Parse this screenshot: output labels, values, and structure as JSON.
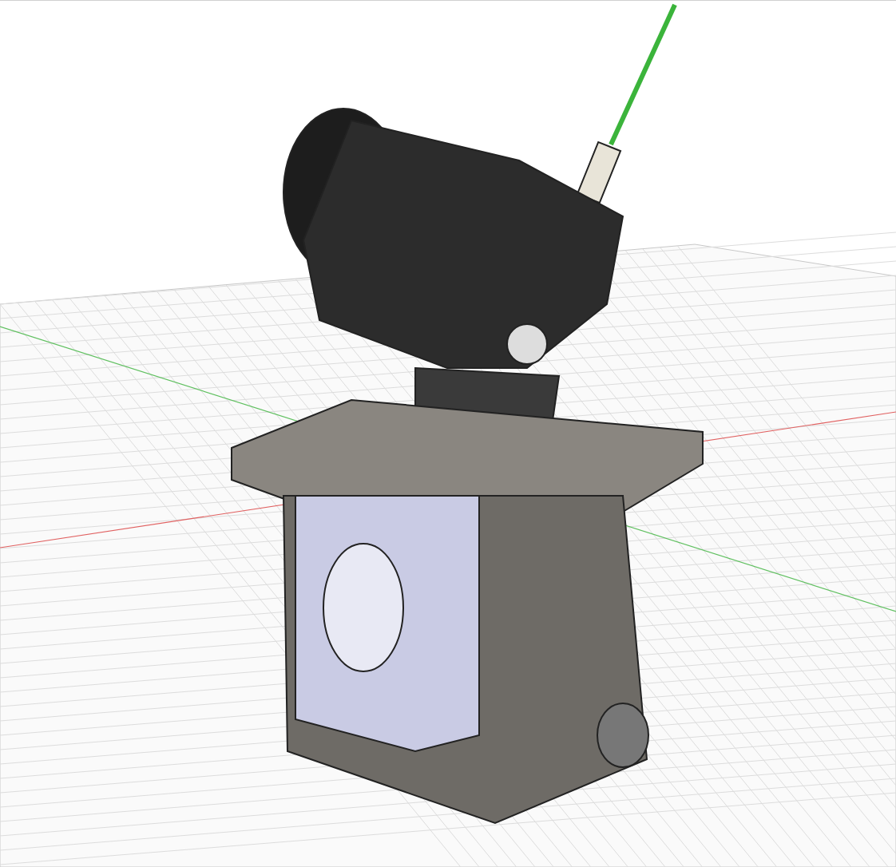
{
  "viewport": {
    "grid_visible": true,
    "axes": [
      {
        "kind": "x",
        "color": "#e06060"
      },
      {
        "kind": "y",
        "color": "#60c060"
      }
    ]
  }
}
